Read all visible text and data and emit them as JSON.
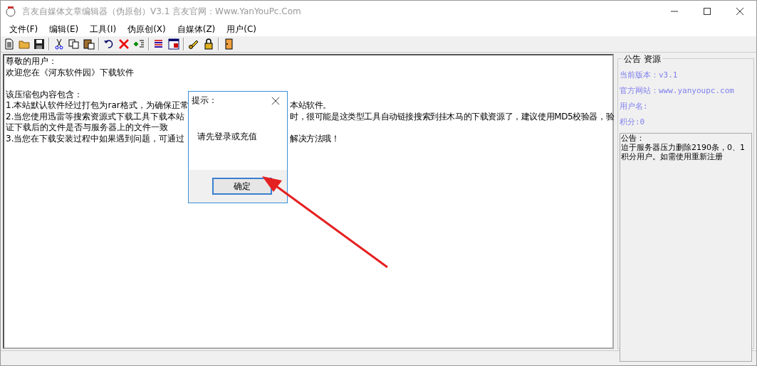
{
  "window": {
    "title": "言友自媒体文章编辑器（伪原创）V3.1 言友官网：Www.YanYouPc.Com"
  },
  "menu": [
    "文件(F)",
    "编辑(E)",
    "工具(I)",
    "伪原创(X)",
    "自媒体(Z)",
    "用户(C)"
  ],
  "editor": {
    "paragraphs": [
      {
        "lines": [
          {
            "parts": [
              "尊敬的用户："
            ]
          },
          {
            "parts": [
              "欢迎您在《河东软件园》下载软件"
            ]
          }
        ]
      },
      {
        "lines": [
          {
            "parts": [
              "该压缩包内容包含："
            ]
          },
          {
            "parts": [
              "1.本站默认软件经过打包为rar格式，为确保正常",
              "本站软件。"
            ]
          },
          {
            "parts": [
              "2.当您使用迅雷等搜索资源式下载工具下载本站",
              "时，很可能是这类型工具自动链接搜索到挂木马的下载资源了，建议使用MD5校验器，验"
            ]
          },
          {
            "parts": [
              "证下载后的文件是否与服务器上的文件一致"
            ]
          },
          {
            "parts": [
              "3.当您在下载安装过程中如果遇到问题，可通过",
              "解决方法哦！"
            ]
          }
        ]
      }
    ]
  },
  "side_panel": {
    "title": "公告 资源",
    "fields": [
      "当前版本：v3.1",
      "官方网站：www.yanyoupc.com",
      "用户名:",
      "积分:0"
    ],
    "notice": [
      "公告：",
      "迫于服务器压力删除2190条，0、1积分用户。如需使用重新注册"
    ]
  },
  "dialog": {
    "title": "提示：",
    "message": "请先登录或充值",
    "button": "确定"
  }
}
